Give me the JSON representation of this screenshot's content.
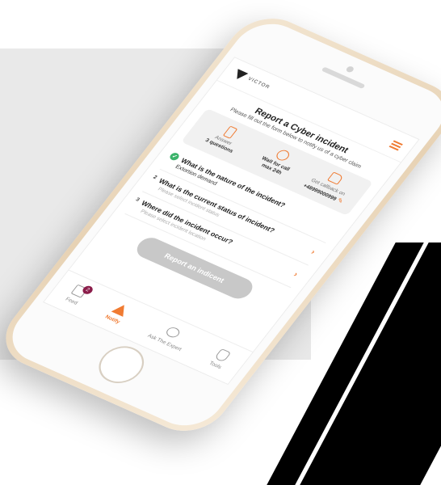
{
  "app": {
    "logo_text": "VICTOR"
  },
  "header": {
    "title": "Report a Cyber incident",
    "subtitle": "Please fill out the form below to notify us of a cyber claim"
  },
  "steps": [
    {
      "icon": "phone-icon",
      "line1": "Answer",
      "line2": "3 questions"
    },
    {
      "icon": "call-icon",
      "line1": "Wait for call",
      "line2": "max 24h"
    },
    {
      "icon": "thumbs-up-icon",
      "line1": "Get callback on",
      "line2": "+48999000999"
    }
  ],
  "questions": [
    {
      "number": "",
      "label": "What is the nature of the incident?",
      "value": "Extortion demand",
      "placeholder": ""
    },
    {
      "number": "2",
      "label": "What is the current status of incident?",
      "value": "",
      "placeholder": "Please select incident status"
    },
    {
      "number": "3",
      "label": "Where did the incident occur?",
      "value": "",
      "placeholder": "Please select incident location"
    }
  ],
  "submit_label": "Report an indicent",
  "tabs": [
    {
      "label": "Feed",
      "icon": "grid-icon",
      "badge": "2"
    },
    {
      "label": "Notify",
      "icon": "warning-icon"
    },
    {
      "label": "Ask The Expert",
      "icon": "chat-bubble-icon"
    },
    {
      "label": "Tools",
      "icon": "shield-icon"
    }
  ],
  "colors": {
    "accent": "#f07b32",
    "success": "#3bb36a",
    "badge": "#8b1d4a"
  }
}
